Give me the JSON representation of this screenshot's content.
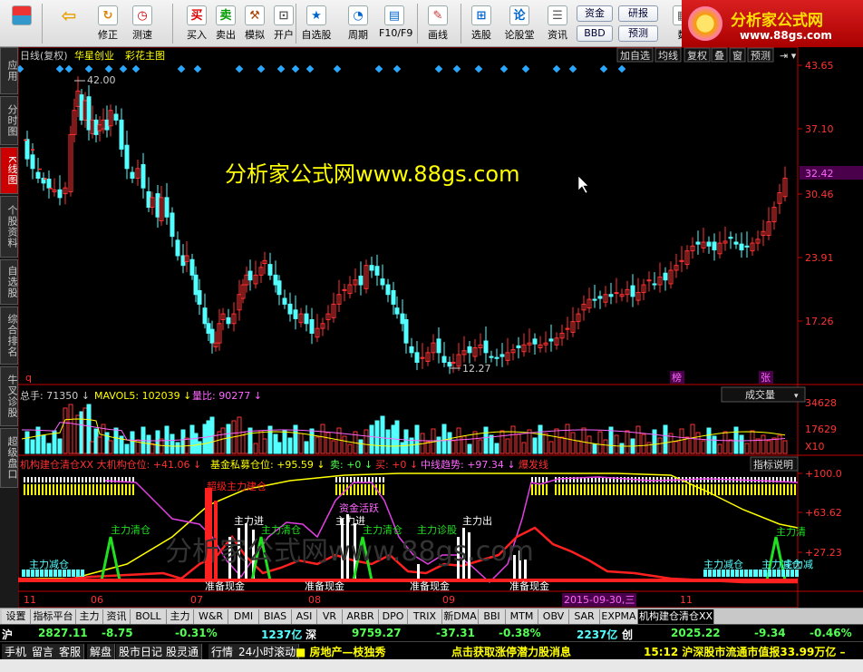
{
  "toolbar": {
    "buttons": [
      {
        "label": "",
        "icon": "grid-app-icon"
      },
      {
        "label": "",
        "icon": "back-arrow-icon"
      },
      {
        "label": "修正",
        "icon": "refresh-icon"
      },
      {
        "label": "测速",
        "icon": "clock-icon"
      },
      {
        "label": "买入",
        "icon": "buy-icon",
        "glyph": "买"
      },
      {
        "label": "卖出",
        "icon": "sell-icon",
        "glyph": "卖"
      },
      {
        "label": "模拟",
        "icon": "hammer-icon"
      },
      {
        "label": "开户",
        "icon": "lock-icon"
      },
      {
        "label": "自选股",
        "icon": "star-icon"
      },
      {
        "label": "周期",
        "icon": "period-icon"
      },
      {
        "label": "F10/F9",
        "icon": "f10-icon"
      },
      {
        "label": "画线",
        "icon": "pen-icon"
      },
      {
        "label": "选股",
        "icon": "pick-stock-icon"
      },
      {
        "label": "论股堂",
        "icon": "forum-icon",
        "glyph": "论"
      },
      {
        "label": "资讯",
        "icon": "news-icon"
      },
      {
        "label": "数",
        "icon": "data-icon"
      }
    ],
    "pills": [
      "资金",
      "研报",
      "BBD",
      "预测"
    ]
  },
  "logo": {
    "title": "分析家公式网",
    "url": "www.88gs.com"
  },
  "left_tabs": [
    "应用",
    "分时图",
    "K线图",
    "个股资料",
    "自选股",
    "综合排名",
    "牛叉诊股",
    "超级盘口"
  ],
  "left_tab_active": 2,
  "chart": {
    "header": {
      "period": "日线(复权)",
      "name": "华星创业",
      "mode": "彩花主图"
    },
    "right_buttons": [
      "加自选",
      "均线",
      "复权",
      "叠",
      "窗",
      "预测"
    ],
    "watermark": "分析家公式网www.88gs.com",
    "price_axis": [
      "43.65",
      "37.10",
      "30.46",
      "23.91",
      "17.26"
    ],
    "current_price": "32.42",
    "high_label": "42.00",
    "low_label": "12.27",
    "marker_q": "q",
    "marker_bang": "榜",
    "marker_zhang": "张",
    "vol_header": {
      "total": "总手: 71350",
      "mavol": "MAVOL5: 102039",
      "ratio": "量比: 90277"
    },
    "vol_dropdown": "成交量",
    "vol_axis": [
      "34628",
      "17629",
      "X10"
    ],
    "ind_header": {
      "a": "机构建仓清仓XX 大机构仓位: +41.06",
      "b": "基金私募仓位: +95.59",
      "c": "卖: +0",
      "d": "买: +0",
      "e": "中线趋势: +97.34",
      "f": "爆发线"
    },
    "ind_button": "指标说明",
    "ind_axis": [
      "+100.0",
      "+63.62",
      "+27.23"
    ],
    "ind_labels": [
      "超级主力建仓",
      "主力进",
      "主力进",
      "资金活跃",
      "主力清仓",
      "主力减仓",
      "主力清仓",
      "主力减仓",
      "主力诊股",
      "准备现金",
      "准备现金",
      "准备现金",
      "准备现金",
      "主力减仓",
      "主力清",
      "主力减",
      "主力清仓",
      "主力出"
    ],
    "ind_watermark": "分析家公式网www.88gs.com",
    "date_axis": [
      "11",
      "06",
      "07",
      "08",
      "09",
      "10",
      "11"
    ],
    "date_cursor": "2015-09-30,三"
  },
  "bottom_tabs": [
    "设置",
    "指标平台",
    "主力",
    "资讯",
    "BOLL",
    "主力",
    "W&R",
    "DMI",
    "BIAS",
    "ASI",
    "VR",
    "ARBR",
    "DPO",
    "TRIX",
    "新DMA",
    "BBI",
    "MTM",
    "OBV",
    "SAR",
    "EXPMA",
    "机构建仓清仓XX"
  ],
  "bottom_tab_active": 20,
  "index_bar": {
    "sh_label": "沪",
    "sh_value": "2827.11",
    "sh_change": "-8.75",
    "sh_pct": "-0.31%",
    "sh_amount": "1237亿",
    "sz_label": "深",
    "sz_value": "9759.27",
    "sz_change": "-37.31",
    "sz_pct": "-0.38%",
    "sz_amount": "2237亿",
    "cy_label": "创",
    "cy_value": "2025.22",
    "cy_change": "-9.34",
    "cy_pct": "-0.46%"
  },
  "status_bar": {
    "items": [
      "手机",
      "留言",
      "客服",
      "解盘",
      "股市日记",
      "股灵通",
      "行情",
      "24小时滚动"
    ],
    "news1": "房地产—枝独秀",
    "news2": "点击获取涨停潜力股消息",
    "news3": "15:12 沪深股市流通市值报33.99万亿 –"
  },
  "colors": {
    "up": "#ff3232",
    "down": "#54ffff",
    "axis": "#c00000",
    "text_yellow": "#ffff00"
  }
}
